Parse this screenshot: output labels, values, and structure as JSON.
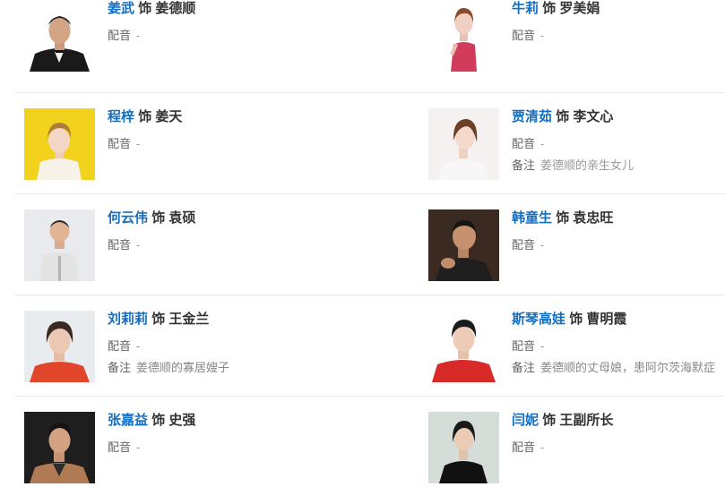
{
  "connector": "饰",
  "labels": {
    "dubbing": "配音",
    "note": "备注"
  },
  "rows": [
    {
      "left": {
        "actor": "姜武",
        "role": "姜德顺",
        "dubbing": "-",
        "note": null
      },
      "right": {
        "actor": "牛莉",
        "role": "罗美娟",
        "dubbing": "-",
        "note": null
      }
    },
    {
      "left": {
        "actor": "程梓",
        "role": "姜天",
        "dubbing": "-",
        "note": null
      },
      "right": {
        "actor": "贾清茹",
        "role": "李文心",
        "dubbing": "-",
        "note": "姜德顺的亲生女儿"
      }
    },
    {
      "left": {
        "actor": "何云伟",
        "role": "袁硕",
        "dubbing": "-",
        "note": null
      },
      "right": {
        "actor": "韩童生",
        "role": "袁忠旺",
        "dubbing": "-",
        "note": null
      }
    },
    {
      "left": {
        "actor": "刘莉莉",
        "role": "王金兰",
        "dubbing": "-",
        "note": "姜德顺的寡居嫂子"
      },
      "right": {
        "actor": "斯琴高娃",
        "role": "曹明霞",
        "dubbing": "-",
        "note": "姜德顺的丈母娘，患阿尔茨海默症"
      }
    },
    {
      "left": {
        "actor": "张嘉益",
        "role": "史强",
        "dubbing": "-",
        "note": null
      },
      "right": {
        "actor": "闫妮",
        "role": "王副所长",
        "dubbing": "-",
        "note": null
      }
    }
  ]
}
